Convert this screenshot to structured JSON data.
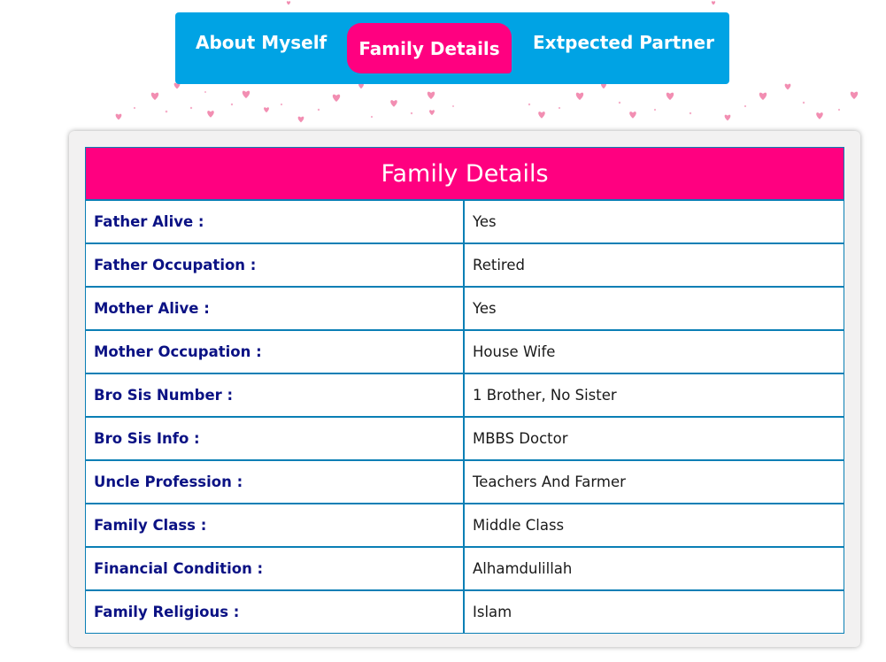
{
  "tabs": [
    {
      "label": "About Myself"
    },
    {
      "label": "Family Details"
    },
    {
      "label": "Extpected Partner"
    }
  ],
  "active_tab": "Family Details",
  "section": {
    "title": "Family Details"
  },
  "rows": [
    {
      "label": "Father Alive :",
      "value": "Yes"
    },
    {
      "label": "Father Occupation :",
      "value": "Retired"
    },
    {
      "label": "Mother Alive :",
      "value": "Yes"
    },
    {
      "label": "Mother Occupation :",
      "value": "House Wife"
    },
    {
      "label": "Bro Sis Number :",
      "value": "1 Brother, No Sister"
    },
    {
      "label": "Bro Sis Info :",
      "value": "MBBS Doctor"
    },
    {
      "label": "Uncle Profession :",
      "value": "Teachers And Farmer"
    },
    {
      "label": "Family Class :",
      "value": "Middle Class"
    },
    {
      "label": "Financial Condition :",
      "value": "Alhamdulillah"
    },
    {
      "label": "Family Religious :",
      "value": "Islam"
    }
  ],
  "colors": {
    "tab_bar": "#00a3e4",
    "accent": "#ff0080",
    "label_text": "#0b1284",
    "border": "#0a7fb5",
    "hearts": "#f07aa5"
  }
}
